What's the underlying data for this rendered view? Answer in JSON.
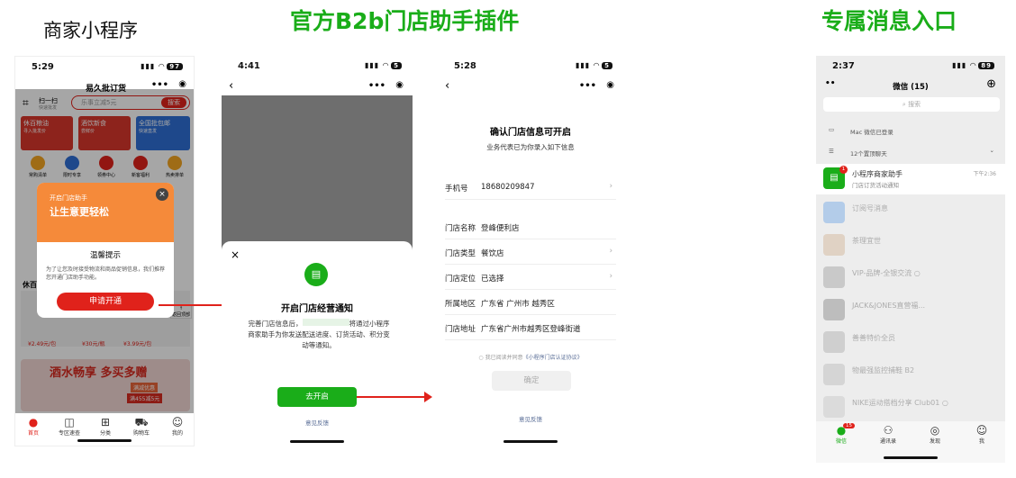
{
  "titles": {
    "merchant": "商家小程序",
    "official": "官方B2b门店助手插件",
    "exclusive": "专属消息入口"
  },
  "phone1": {
    "time": "5:29",
    "battery": "97",
    "app_name": "易久批订货",
    "scan_label": "扫一扫",
    "scan_sub": "快速批发",
    "search_placeholder": "乐事立减5元",
    "search_btn": "搜索",
    "banners": [
      {
        "t": "休百粮油",
        "s": "寻入批发价"
      },
      {
        "t": "酒饮新食",
        "s": "尝鲜价"
      },
      {
        "t": "全国批包邮",
        "s": "快速直发"
      }
    ],
    "icons": [
      "常购清单",
      "限时专享",
      "领券中心",
      "新客福利",
      "热卖排单"
    ],
    "popup": {
      "banner1": "开启门店助手",
      "banner2": "让生意更轻松",
      "title": "温馨提示",
      "body": "为了让您及时接受物流和商品促销信息，我们推荐您开通门店助手功能。",
      "btn": "申请开通"
    },
    "section": "休百",
    "prices": [
      "¥2.49元/包",
      "¥30元/瓶",
      "¥3.99元/包"
    ],
    "back_top": "返回顶部",
    "promo": "酒水畅享 多买多赠",
    "promo_tag": "满455减5元",
    "promo_tag2": "满减优惠",
    "tabs": [
      "首页",
      "专区速查",
      "分类",
      "购物车",
      "我的"
    ]
  },
  "phone2": {
    "time": "4:41",
    "title": "开启门店经营通知",
    "body1": "完善门店信息后，",
    "body2": "将通过小程序",
    "body3": "商家助手为你发送配送进度、订货活动、积分变",
    "body4": "动等通知。",
    "btn": "去开启",
    "feedback": "意见反馈",
    "battery": "5"
  },
  "phone3": {
    "time": "5:28",
    "title": "确认门店信息可开启",
    "sub": "业务代表已为你录入如下信息",
    "battery": "5",
    "rows": [
      {
        "l": "手机号",
        "v": "18680209847"
      },
      {
        "l": "门店名称",
        "v": "登峰便利店"
      },
      {
        "l": "门店类型",
        "v": "餐饮店"
      },
      {
        "l": "门店定位",
        "v": "已选择"
      },
      {
        "l": "所属地区",
        "v": "广东省 广州市 越秀区"
      },
      {
        "l": "门店地址",
        "v": "广东省广州市越秀区登峰街道"
      }
    ],
    "agree": "我已阅读并同意",
    "agree_link": "《小程序门店认证协议》",
    "btn": "确定",
    "feedback": "意见反馈"
  },
  "phone4": {
    "time": "2:37",
    "battery": "89",
    "title": "微信 (15)",
    "search": "搜索",
    "mac": "Mac 微信已登录",
    "pinned": "12个置顶聊天",
    "chats": [
      {
        "n": "小程序商家助手",
        "s": "门店订货活动通知",
        "t": "下午2:36",
        "badge": "1"
      },
      {
        "n": "订阅号消息",
        "s": "",
        "t": ""
      },
      {
        "n": "茶理宜世",
        "s": "",
        "t": ""
      },
      {
        "n": "VIP-品牌-全银交流 ○",
        "s": "",
        "t": ""
      },
      {
        "n": "JACK&JONES直营福...",
        "s": "",
        "t": ""
      },
      {
        "n": "善善特价全员",
        "s": "",
        "t": ""
      },
      {
        "n": "物最强监控捕鞋 B2",
        "s": "",
        "t": ""
      },
      {
        "n": "NIKE运动搭档分享 Club01 ○",
        "s": "",
        "t": ""
      }
    ],
    "tabs": [
      "微信",
      "通讯录",
      "发现",
      "我"
    ],
    "tab_badge": "15"
  },
  "colors": {
    "green": "#1aad19",
    "red": "#e0221b",
    "orange": "#f5a623"
  }
}
